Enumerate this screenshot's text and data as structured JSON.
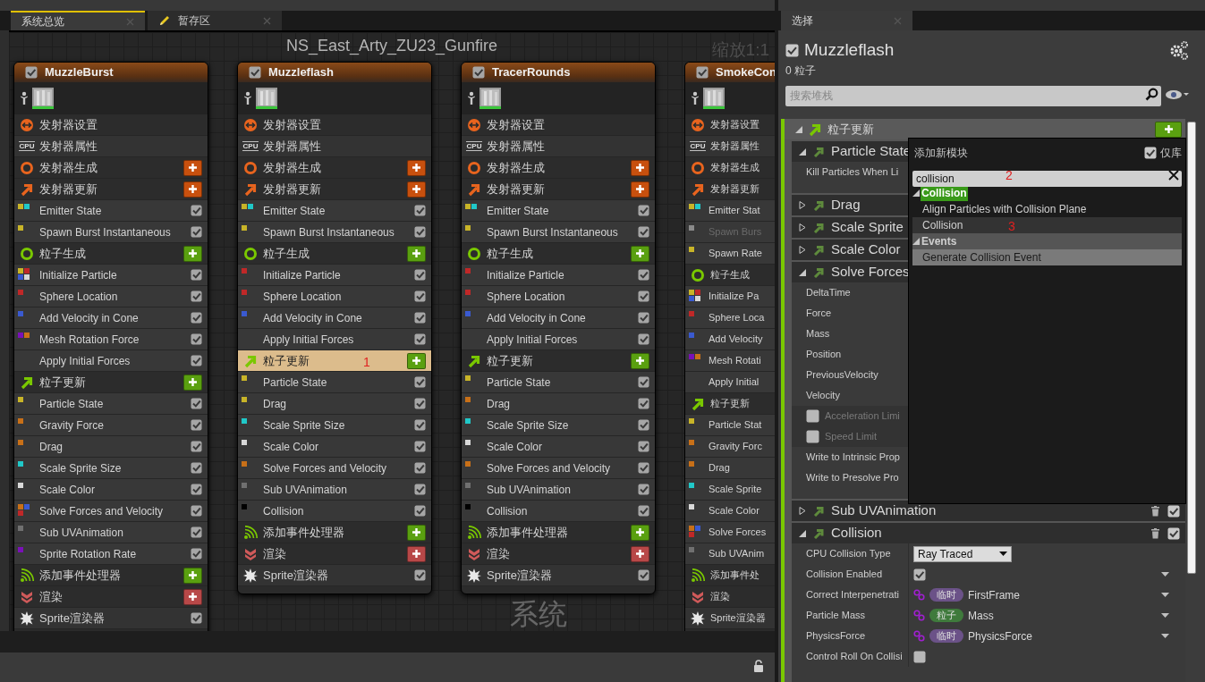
{
  "tabs": [
    {
      "label": "系统总览",
      "kind": "overview",
      "selected": true
    },
    {
      "label": "暂存区",
      "kind": "scratchpad",
      "selected": false
    }
  ],
  "graph": {
    "title": "NS_East_Arty_ZU23_Gunfire",
    "zoom": "缩放1:1",
    "watermark": "系统",
    "emitters": [
      {
        "name": "MuzzleBurst",
        "enabled": true,
        "cut_off": false,
        "rows": [
          {
            "kind": "emitter_settings",
            "label": "发射器设置",
            "selected": false
          },
          {
            "kind": "emitter_properties",
            "badge": "CPU",
            "label": "发射器属性",
            "selected": false
          },
          {
            "kind": "emitter_spawn",
            "label": "发射器生成",
            "add_button": true,
            "selected": false
          },
          {
            "kind": "emitter_update",
            "label": "发射器更新",
            "add_button": true,
            "selected": false
          },
          {
            "kind": "module",
            "label": "Emitter State",
            "dots": [
              {
                "color": "#c8b428"
              },
              {
                "color": "#20c8c8"
              }
            ],
            "checked": true,
            "selected": false
          },
          {
            "kind": "module",
            "label": "Spawn Burst Instantaneous",
            "dots": [
              {
                "color": "#c8b428"
              }
            ],
            "checked": true,
            "selected": false
          },
          {
            "kind": "particle_spawn",
            "label": "粒子生成",
            "add_button": true,
            "selected": false
          },
          {
            "kind": "module",
            "label": "Initialize Particle",
            "dots": [
              {
                "color": "#c8b428"
              },
              {
                "color": "#c02828"
              },
              {
                "color": "#3a5ad0"
              },
              {
                "color": "#d8d8d8"
              }
            ],
            "checked": true,
            "selected": false
          },
          {
            "kind": "module",
            "label": "Sphere Location",
            "dots": [
              {
                "color": "#c02828"
              }
            ],
            "checked": true,
            "selected": false
          },
          {
            "kind": "module",
            "label": "Add Velocity in Cone",
            "dots": [
              {
                "color": "#3a5ad0"
              }
            ],
            "checked": true,
            "selected": false
          },
          {
            "kind": "module",
            "label": "Mesh Rotation Force",
            "dots": [
              {
                "color": "#7a10b8"
              },
              {
                "color": "#c87018"
              }
            ],
            "checked": true,
            "selected": false
          },
          {
            "kind": "module",
            "label": "Apply Initial Forces",
            "checked": true,
            "selected": false
          },
          {
            "kind": "particle_update",
            "label": "粒子更新",
            "add_button": true,
            "selected": false
          },
          {
            "kind": "module",
            "label": "Particle State",
            "dots": [
              {
                "color": "#c8b428"
              }
            ],
            "checked": true,
            "selected": false
          },
          {
            "kind": "module",
            "label": "Gravity Force",
            "dots": [
              {
                "color": "#c87018"
              }
            ],
            "checked": true,
            "selected": false
          },
          {
            "kind": "module",
            "label": "Drag",
            "dots": [
              {
                "color": "#c87018"
              }
            ],
            "checked": true,
            "selected": false
          },
          {
            "kind": "module",
            "label": "Scale Sprite Size",
            "dots": [
              {
                "color": "#20c8c8"
              }
            ],
            "checked": true,
            "selected": false
          },
          {
            "kind": "module",
            "label": "Scale Color",
            "dots": [
              {
                "color": "#d8d8d8"
              }
            ],
            "checked": true,
            "selected": false
          },
          {
            "kind": "module",
            "label": "Solve Forces and Velocity",
            "dots": [
              {
                "color": "#c87018"
              },
              {
                "color": "#3a5ad0"
              },
              {
                "color": "#c02828"
              }
            ],
            "checked": true,
            "selected": false
          },
          {
            "kind": "module",
            "label": "Sub UVAnimation",
            "dots": [
              {
                "color": "#707070"
              }
            ],
            "checked": true,
            "selected": false
          },
          {
            "kind": "module",
            "label": "Sprite Rotation Rate",
            "dots": [
              {
                "color": "#7a10b8"
              }
            ],
            "checked": true,
            "selected": false
          },
          {
            "kind": "events",
            "label": "添加事件处理器",
            "add_button": true,
            "selected": false
          },
          {
            "kind": "render",
            "label": "渲染",
            "add_button": true,
            "selected": false
          },
          {
            "kind": "renderer",
            "label": "Sprite渲染器",
            "checked": true,
            "selected": false
          }
        ]
      },
      {
        "name": "Muzzleflash",
        "enabled": true,
        "cut_off": false,
        "rows": [
          {
            "kind": "emitter_settings",
            "label": "发射器设置",
            "selected": false
          },
          {
            "kind": "emitter_properties",
            "badge": "CPU",
            "label": "发射器属性",
            "selected": false
          },
          {
            "kind": "emitter_spawn",
            "label": "发射器生成",
            "add_button": true,
            "selected": false
          },
          {
            "kind": "emitter_update",
            "label": "发射器更新",
            "add_button": true,
            "selected": false
          },
          {
            "kind": "module",
            "label": "Emitter State",
            "dots": [
              {
                "color": "#c8b428"
              },
              {
                "color": "#20c8c8"
              }
            ],
            "checked": true,
            "selected": false
          },
          {
            "kind": "module",
            "label": "Spawn Burst Instantaneous",
            "dots": [
              {
                "color": "#c8b428"
              }
            ],
            "checked": true,
            "selected": false
          },
          {
            "kind": "particle_spawn",
            "label": "粒子生成",
            "add_button": true,
            "selected": false
          },
          {
            "kind": "module",
            "label": "Initialize Particle",
            "dots": [
              {
                "color": "#c02828"
              }
            ],
            "checked": true,
            "selected": false
          },
          {
            "kind": "module",
            "label": "Sphere Location",
            "dots": [
              {
                "color": "#c02828"
              }
            ],
            "checked": true,
            "selected": false
          },
          {
            "kind": "module",
            "label": "Add Velocity in Cone",
            "dots": [
              {
                "color": "#3a5ad0"
              }
            ],
            "checked": true,
            "selected": false
          },
          {
            "kind": "module",
            "label": "Apply Initial Forces",
            "checked": true,
            "selected": false
          },
          {
            "kind": "particle_update",
            "label": "粒子更新",
            "add_button": true,
            "selected": true,
            "annotation": "1"
          },
          {
            "kind": "module",
            "label": "Particle State",
            "dots": [
              {
                "color": "#c8b428"
              }
            ],
            "checked": true,
            "selected": false
          },
          {
            "kind": "module",
            "label": "Drag",
            "dots": [
              {
                "color": "#c8b428"
              }
            ],
            "checked": true,
            "selected": false
          },
          {
            "kind": "module",
            "label": "Scale Sprite Size",
            "dots": [
              {
                "color": "#20c8c8"
              }
            ],
            "checked": true,
            "selected": false
          },
          {
            "kind": "module",
            "label": "Scale Color",
            "dots": [
              {
                "color": "#d8d8d8"
              }
            ],
            "checked": true,
            "selected": false
          },
          {
            "kind": "module",
            "label": "Solve Forces and Velocity",
            "dots": [
              {
                "color": "#c87018"
              }
            ],
            "checked": true,
            "selected": false
          },
          {
            "kind": "module",
            "label": "Sub UVAnimation",
            "dots": [
              {
                "color": "#707070"
              }
            ],
            "checked": true,
            "selected": false
          },
          {
            "kind": "module",
            "label": "Collision",
            "dots": [
              {
                "color": "#000000"
              }
            ],
            "checked": true,
            "selected": false
          },
          {
            "kind": "events",
            "label": "添加事件处理器",
            "add_button": true,
            "selected": false
          },
          {
            "kind": "render",
            "label": "渲染",
            "add_button": true,
            "selected": false
          },
          {
            "kind": "renderer",
            "label": "Sprite渲染器",
            "checked": true,
            "selected": false
          }
        ]
      },
      {
        "name": "TracerRounds",
        "enabled": true,
        "cut_off": false,
        "rows": [
          {
            "kind": "emitter_settings",
            "label": "发射器设置",
            "selected": false
          },
          {
            "kind": "emitter_properties",
            "badge": "CPU",
            "label": "发射器属性",
            "selected": false
          },
          {
            "kind": "emitter_spawn",
            "label": "发射器生成",
            "add_button": true,
            "selected": false
          },
          {
            "kind": "emitter_update",
            "label": "发射器更新",
            "add_button": true,
            "selected": false
          },
          {
            "kind": "module",
            "label": "Emitter State",
            "dots": [
              {
                "color": "#c8b428"
              },
              {
                "color": "#20c8c8"
              }
            ],
            "checked": true,
            "selected": false
          },
          {
            "kind": "module",
            "label": "Spawn Burst Instantaneous",
            "dots": [
              {
                "color": "#c8b428"
              }
            ],
            "checked": true,
            "selected": false
          },
          {
            "kind": "particle_spawn",
            "label": "粒子生成",
            "add_button": true,
            "selected": false
          },
          {
            "kind": "module",
            "label": "Initialize Particle",
            "dots": [
              {
                "color": "#c02828"
              }
            ],
            "checked": true,
            "selected": false
          },
          {
            "kind": "module",
            "label": "Sphere Location",
            "dots": [
              {
                "color": "#c02828"
              }
            ],
            "checked": true,
            "selected": false
          },
          {
            "kind": "module",
            "label": "Add Velocity in Cone",
            "dots": [
              {
                "color": "#3a5ad0"
              }
            ],
            "checked": true,
            "selected": false
          },
          {
            "kind": "module",
            "label": "Apply Initial Forces",
            "checked": true,
            "selected": false
          },
          {
            "kind": "particle_update",
            "label": "粒子更新",
            "add_button": true,
            "selected": false
          },
          {
            "kind": "module",
            "label": "Particle State",
            "dots": [
              {
                "color": "#c8b428"
              }
            ],
            "checked": true,
            "selected": false
          },
          {
            "kind": "module",
            "label": "Drag",
            "dots": [
              {
                "color": "#c87018"
              }
            ],
            "checked": true,
            "selected": false
          },
          {
            "kind": "module",
            "label": "Scale Sprite Size",
            "dots": [
              {
                "color": "#20c8c8"
              }
            ],
            "checked": true,
            "selected": false
          },
          {
            "kind": "module",
            "label": "Scale Color",
            "dots": [
              {
                "color": "#d8d8d8"
              }
            ],
            "checked": true,
            "selected": false
          },
          {
            "kind": "module",
            "label": "Solve Forces and Velocity",
            "dots": [
              {
                "color": "#c87018"
              }
            ],
            "checked": true,
            "selected": false
          },
          {
            "kind": "module",
            "label": "Sub UVAnimation",
            "dots": [
              {
                "color": "#707070"
              }
            ],
            "checked": true,
            "selected": false
          },
          {
            "kind": "module",
            "label": "Collision",
            "dots": [
              {
                "color": "#000000"
              }
            ],
            "checked": true,
            "selected": false
          },
          {
            "kind": "events",
            "label": "添加事件处理器",
            "add_button": true,
            "selected": false
          },
          {
            "kind": "render",
            "label": "渲染",
            "add_button": true,
            "selected": false
          },
          {
            "kind": "renderer",
            "label": "Sprite渲染器",
            "checked": true,
            "selected": false
          }
        ]
      },
      {
        "name": "SmokeCon",
        "enabled": true,
        "cut_off": true,
        "rows": [
          {
            "kind": "emitter_settings",
            "label": "发射器设置",
            "selected": false
          },
          {
            "kind": "emitter_properties",
            "badge": "CPU",
            "label": "发射器属性",
            "selected": false
          },
          {
            "kind": "emitter_spawn",
            "label": "发射器生成",
            "selected": false
          },
          {
            "kind": "emitter_update",
            "label": "发射器更新",
            "selected": false
          },
          {
            "kind": "module",
            "label": "Emitter Stat",
            "dots": [
              {
                "color": "#c8b428"
              },
              {
                "color": "#20c8c8"
              }
            ],
            "disabled": false,
            "selected": false
          },
          {
            "kind": "module",
            "label": "Spawn Burs",
            "dots": [
              {
                "color": "#8a8a8a"
              }
            ],
            "disabled": true,
            "selected": false
          },
          {
            "kind": "module",
            "label": "Spawn Rate",
            "dots": [
              {
                "color": "#c8b428"
              }
            ],
            "disabled": false,
            "selected": false
          },
          {
            "kind": "particle_spawn",
            "label": "粒子生成",
            "selected": false
          },
          {
            "kind": "module",
            "label": "Initialize Pa",
            "dots": [
              {
                "color": "#c8b428"
              },
              {
                "color": "#c02828"
              },
              {
                "color": "#3a5ad0"
              },
              {
                "color": "#d8d8d8"
              }
            ],
            "disabled": false,
            "selected": false
          },
          {
            "kind": "module",
            "label": "Sphere Loca",
            "dots": [
              {
                "color": "#c02828"
              }
            ],
            "disabled": false,
            "selected": false
          },
          {
            "kind": "module",
            "label": "Add Velocity",
            "dots": [
              {
                "color": "#3a5ad0"
              }
            ],
            "disabled": false,
            "selected": false
          },
          {
            "kind": "module",
            "label": "Mesh Rotati",
            "dots": [
              {
                "color": "#7a10b8"
              },
              {
                "color": "#c87018"
              }
            ],
            "disabled": false,
            "selected": false
          },
          {
            "kind": "module",
            "label": "Apply Initial",
            "disabled": false,
            "selected": false
          },
          {
            "kind": "particle_update",
            "label": "粒子更新",
            "selected": false
          },
          {
            "kind": "module",
            "label": "Particle Stat",
            "dots": [
              {
                "color": "#c8b428"
              }
            ],
            "disabled": false,
            "selected": false
          },
          {
            "kind": "module",
            "label": "Gravity Forc",
            "dots": [
              {
                "color": "#c87018"
              }
            ],
            "disabled": false,
            "selected": false
          },
          {
            "kind": "module",
            "label": "Drag",
            "dots": [
              {
                "color": "#c87018"
              }
            ],
            "disabled": false,
            "selected": false
          },
          {
            "kind": "module",
            "label": "Scale Sprite",
            "dots": [
              {
                "color": "#20c8c8"
              }
            ],
            "disabled": false,
            "selected": false
          },
          {
            "kind": "module",
            "label": "Scale Color",
            "dots": [
              {
                "color": "#d8d8d8"
              }
            ],
            "disabled": false,
            "selected": false
          },
          {
            "kind": "module",
            "label": "Solve Forces",
            "dots": [
              {
                "color": "#c87018"
              },
              {
                "color": "#3a5ad0"
              },
              {
                "color": "#c02828"
              }
            ],
            "disabled": false,
            "selected": false
          },
          {
            "kind": "module",
            "label": "Sub UVAnim",
            "dots": [
              {
                "color": "#707070"
              }
            ],
            "disabled": false,
            "selected": false
          },
          {
            "kind": "events",
            "label": "添加事件处",
            "selected": false
          },
          {
            "kind": "render",
            "label": "渲染",
            "selected": false
          },
          {
            "kind": "renderer",
            "label": "Sprite渲染器",
            "selected": false
          }
        ]
      }
    ]
  },
  "selection_panel": {
    "tab": "选择",
    "emitter": {
      "name": "Muzzleflash",
      "enabled": true
    },
    "particle_count": "0 粒子",
    "search": {
      "placeholder": "搜索堆栈"
    },
    "stack": {
      "section": "粒子更新",
      "modules": [
        {
          "name": "Particle State",
          "expanded": true,
          "params": [
            {
              "kind": "plain",
              "label": "Kill Particles When Li"
            }
          ]
        },
        {
          "name": "Drag",
          "expanded": false
        },
        {
          "name": "Scale Sprite",
          "expanded": false
        },
        {
          "name": "Scale Color",
          "expanded": false
        },
        {
          "name": "Solve Forces",
          "expanded": true,
          "params": [
            {
              "kind": "plain",
              "label": "DeltaTime"
            },
            {
              "kind": "plain",
              "label": "Force"
            },
            {
              "kind": "plain",
              "label": "Mass"
            },
            {
              "kind": "plain",
              "label": "Position"
            },
            {
              "kind": "plain",
              "label": "PreviousVelocity"
            },
            {
              "kind": "plain",
              "label": "Velocity"
            },
            {
              "kind": "toggle",
              "label": "Acceleration Limi",
              "checked": false
            },
            {
              "kind": "toggle",
              "label": "Speed Limit",
              "checked": false
            },
            {
              "kind": "plain",
              "label": "Write to Intrinsic Prop"
            },
            {
              "kind": "plain",
              "label": "Write to Presolve Pro"
            }
          ]
        },
        {
          "name": "Sub UVAnimation",
          "expanded": false,
          "enabled": true
        },
        {
          "name": "Collision",
          "expanded": true,
          "enabled": true,
          "params": [
            {
              "kind": "dropdown",
              "label": "CPU Collision Type",
              "value": "Ray Traced"
            },
            {
              "kind": "bool",
              "label": "Collision Enabled",
              "checked": true,
              "menu_caret": true
            },
            {
              "kind": "linked",
              "label": "Correct Interpenetrati",
              "tag": "临时",
              "color": "#6b5288",
              "value": "FirstFrame",
              "menu_caret": true
            },
            {
              "kind": "linked",
              "label": "Particle Mass",
              "tag": "粒子",
              "color": "#3f7a3c",
              "value": "Mass",
              "menu_caret": true
            },
            {
              "kind": "linked",
              "label": "PhysicsForce",
              "tag": "临时",
              "color": "#6b5288",
              "value": "PhysicsForce",
              "menu_caret": true
            },
            {
              "kind": "bool",
              "label": "Control Roll On Collisi",
              "checked": false,
              "menu_caret": false
            }
          ]
        }
      ]
    }
  },
  "add_module_popup": {
    "title": "添加新模块",
    "library_only": {
      "label": "仅库",
      "checked": true
    },
    "search": {
      "value": "collision",
      "annotation": "2"
    },
    "groups": [
      {
        "name": "Collision",
        "highlighted": true,
        "items": [
          {
            "label": "Align Particles with Collision Plane",
            "selected": false
          },
          {
            "label": "Collision",
            "selected": false,
            "hovered": true,
            "annotation": "3"
          }
        ]
      },
      {
        "name": "Events",
        "highlighted": false,
        "items": [
          {
            "label": "Generate Collision Event",
            "selected": true
          }
        ]
      }
    ]
  }
}
